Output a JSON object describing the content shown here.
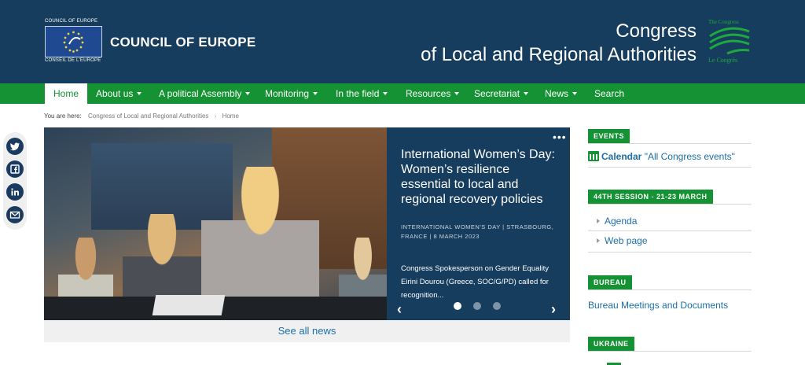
{
  "header": {
    "coe_logo_top": "COUNCIL OF EUROPE",
    "coe_logo_bottom": "CONSEIL DE L'EUROPE",
    "coe_title": "COUNCIL OF EUROPE",
    "congress_line1": "Congress",
    "congress_line2": "of Local and Regional Authorities",
    "congress_logo_top": "The Congress",
    "congress_logo_bottom": "Le Congrès"
  },
  "nav": {
    "items": [
      {
        "label": "Home",
        "active": true
      },
      {
        "label": "About us",
        "dropdown": true
      },
      {
        "label": "A political Assembly",
        "dropdown": true
      },
      {
        "label": "Monitoring",
        "dropdown": true
      },
      {
        "label": "In the field",
        "dropdown": true
      },
      {
        "label": "Resources",
        "dropdown": true
      },
      {
        "label": "Secretariat",
        "dropdown": true
      },
      {
        "label": "News",
        "dropdown": true
      },
      {
        "label": "Search"
      }
    ]
  },
  "breadcrumb": {
    "prefix": "You are here:",
    "items": [
      "Congress of Local and Regional Authorities",
      "Home"
    ]
  },
  "social": [
    "twitter-icon",
    "facebook-icon",
    "linkedin-icon",
    "email-icon"
  ],
  "slider": {
    "title": "International Women’s Day: Women’s resilience essential to local and regional recovery policies",
    "meta": "INTERNATIONAL WOMEN'S DAY | STRASBOURG, FRANCE | 8 MARCH 2023",
    "description": "Congress Spokesperson on Gender Equality Eirini Dourou (Greece, SOC/G/PD) called for recognition...",
    "dots": 3,
    "active_dot": 1,
    "see_all": "See all news"
  },
  "sidebar": {
    "events_label": "EVENTS",
    "calendar_bold": "Calendar",
    "calendar_text": "\"All Congress events\"",
    "session_label": "44TH SESSION - 21-23 MARCH",
    "session_links": [
      "Agenda",
      "Web page"
    ],
    "bureau_label": "BUREAU",
    "bureau_link": "Bureau Meetings and Documents",
    "ukraine_label": "UKRAINE"
  },
  "colors": {
    "header_bg": "#163d5e",
    "nav_green": "#159233",
    "link_blue": "#1b6fa8"
  }
}
